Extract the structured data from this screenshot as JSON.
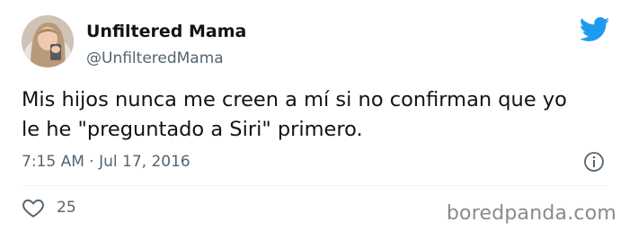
{
  "tweet": {
    "author_name": "Unfiltered Mama",
    "handle": "@UnfilteredMama",
    "text": "Mis hijos nunca me creen a mí si no confirman que yo\nle he \"preguntado a Siri\" primero.",
    "timestamp": "7:15 AM · Jul 17, 2016",
    "like_count": "25"
  },
  "icons": {
    "brand": "twitter-bird-icon",
    "info": "info-icon",
    "like": "heart-icon"
  },
  "colors": {
    "twitter_blue": "#1d9bf0",
    "secondary_text": "#536471",
    "primary_text": "#0f1419"
  },
  "watermark": "boredpanda.com"
}
